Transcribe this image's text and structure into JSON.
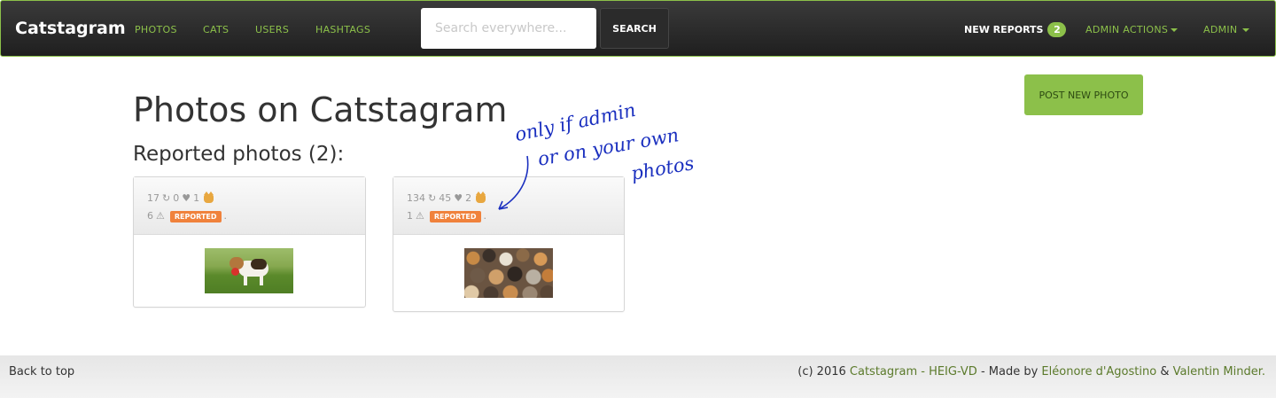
{
  "navbar": {
    "brand": "Catstagram",
    "links": [
      "PHOTOS",
      "CATS",
      "USERS",
      "HASHTAGS"
    ],
    "search_placeholder": "Search everywhere...",
    "search_label": "SEARCH",
    "reports_label": "NEW REPORTS",
    "reports_count": "2",
    "admin_actions_label": "ADMIN ACTIONS",
    "admin_label": "ADMIN"
  },
  "main": {
    "title": "Photos on Catstagram",
    "section_title": "Reported photos (2):",
    "post_button": "POST NEW PHOTO",
    "photos": [
      {
        "reposts": "17",
        "likes": "0",
        "cats": "1",
        "reports": "6",
        "badge": "REPORTED",
        "image": "beagle-puppy-photo"
      },
      {
        "reposts": "134",
        "likes": "45",
        "cats": "2",
        "reports": "1",
        "badge": "REPORTED",
        "image": "many-cats-photo"
      }
    ],
    "annotation": [
      "only if admin",
      "or on your own",
      "photos"
    ]
  },
  "footer": {
    "back_to_top": "Back to top",
    "copyright": "(c) 2016",
    "site_link": "Catstagram - HEIG-VD",
    "made_by": "- Made by",
    "author1": "Eléonore d'Agostino",
    "amp": "&",
    "author2": "Valentin Minder."
  },
  "colors": {
    "accent": "#8cc04a",
    "reported": "#f0823c",
    "annotation_ink": "#1a2fbf",
    "navbar_bg": "#262626"
  }
}
